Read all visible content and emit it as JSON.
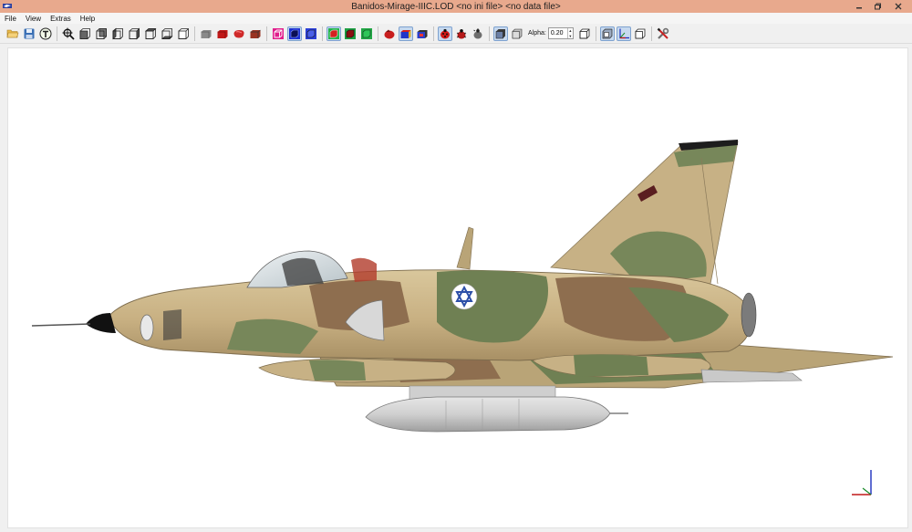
{
  "window": {
    "title": "Banidos-Mirage-IIIC.LOD  <no ini file>  <no data file>"
  },
  "menu": [
    "File",
    "View",
    "Extras",
    "Help"
  ],
  "toolbar": {
    "alpha_label": "Alpha:",
    "alpha_value": "0.20"
  },
  "colors": {
    "titlebar": "#e8a98d",
    "camo_tan": "#c9b48a",
    "camo_green": "#77875a",
    "camo_brown": "#8e6e4f",
    "roundel_blue": "#2c4fa8"
  }
}
